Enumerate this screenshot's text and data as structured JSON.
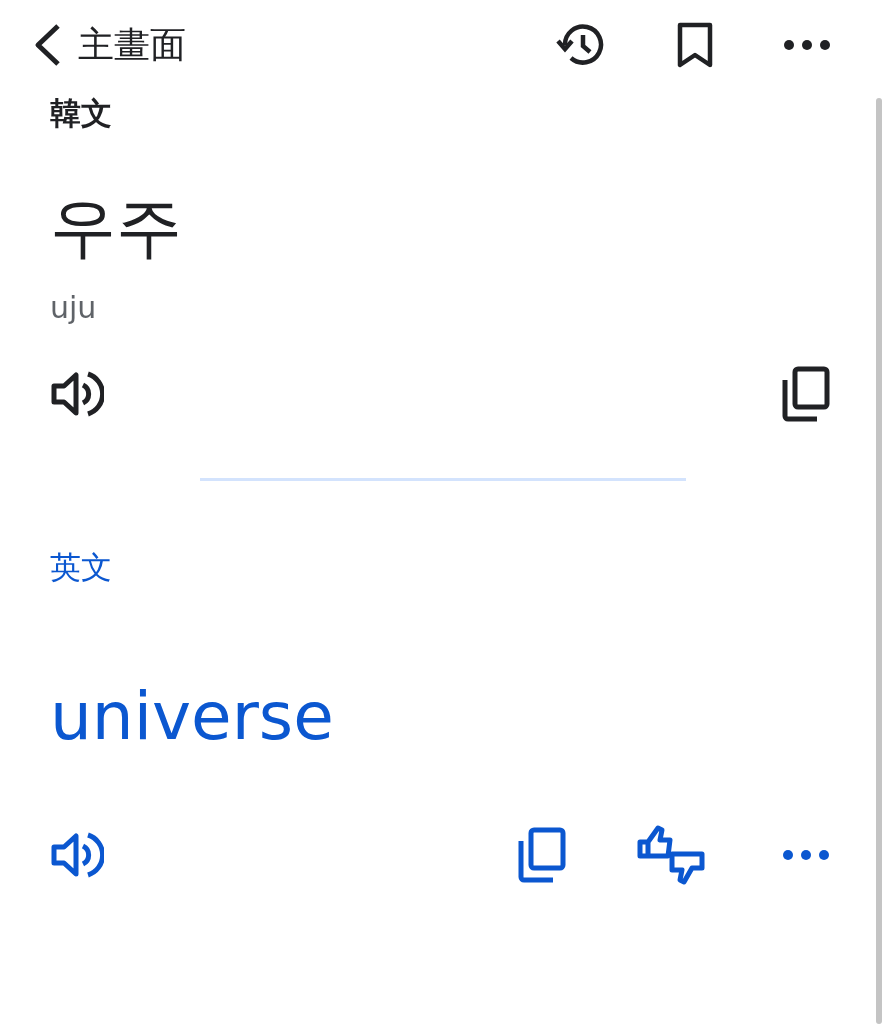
{
  "top_bar": {
    "back_label": "主畫面"
  },
  "source": {
    "language": "韓文",
    "text": "우주",
    "romanization": "uju"
  },
  "target": {
    "language": "英文",
    "text": "universe"
  }
}
